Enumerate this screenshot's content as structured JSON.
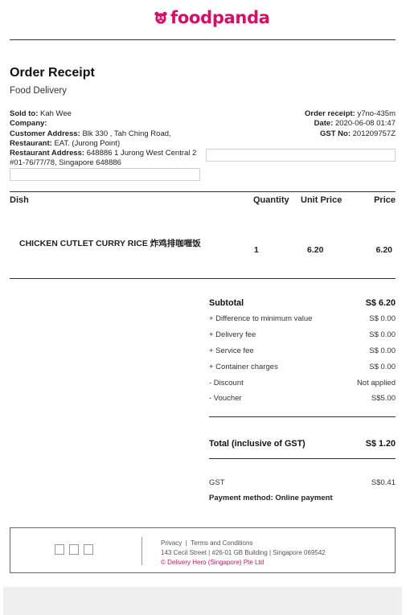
{
  "brand": {
    "name": "foodpanda",
    "color": "#d70f64",
    "icon": "panda-icon"
  },
  "receipt": {
    "title": "Order Receipt",
    "subtitle": "Food Delivery",
    "sold_to_label": "Sold to:",
    "sold_to": "Kah Wee",
    "company_label": "Company:",
    "company": "",
    "customer_address_label": "Customer Address:",
    "customer_address": "Blk 330 , Tah Ching Road,",
    "restaurant_label": "Restaurant:",
    "restaurant": "EAT. (Jurong Point)",
    "restaurant_address_label": "Restaurant Address:",
    "restaurant_address": "648886 1 Jurong West Central 2 #01-76/77/78, Singapore 648886",
    "order_receipt_label": "Order receipt:",
    "order_receipt": "y7no-435m",
    "date_label": "Date:",
    "date": "2020-06-08 01:47",
    "gst_no_label": "GST No:",
    "gst_no": "201209757Z"
  },
  "table": {
    "headers": {
      "dish": "Dish",
      "quantity": "Quantity",
      "unit_price": "Unit Price",
      "price": "Price"
    },
    "items": [
      {
        "dish": "CHICKEN CUTLET CURRY RICE 炸鸡排咖喱饭",
        "quantity": "1",
        "unit_price": "6.20",
        "price": "6.20"
      }
    ]
  },
  "summary": {
    "subtotal_label": "Subtotal",
    "subtotal": "S$ 6.20",
    "lines": [
      {
        "label": "+ Difference to minimum value",
        "value": "S$ 0.00"
      },
      {
        "label": "+ Delivery fee",
        "value": "S$ 0.00"
      },
      {
        "label": "+ Service fee",
        "value": "S$ 0.00"
      },
      {
        "label": "+ Container charges",
        "value": "S$ 0.00"
      },
      {
        "label": "- Discount",
        "value": "Not applied"
      },
      {
        "label": "- Voucher",
        "value": "S$5.00"
      }
    ],
    "total_label": "Total (inclusive of GST)",
    "total": "S$ 1.20",
    "gst_label": "GST",
    "gst": "S$0.41",
    "payment": "Payment method: Online payment"
  },
  "footer": {
    "privacy": "Privacy",
    "separator": "|",
    "terms": "Terms and Conditions",
    "address": "143 Cecil Street | #26-01 GB Building | Singapore 069542",
    "copyright": "© Delivery Hero (Singapore) Pte Ltd"
  }
}
